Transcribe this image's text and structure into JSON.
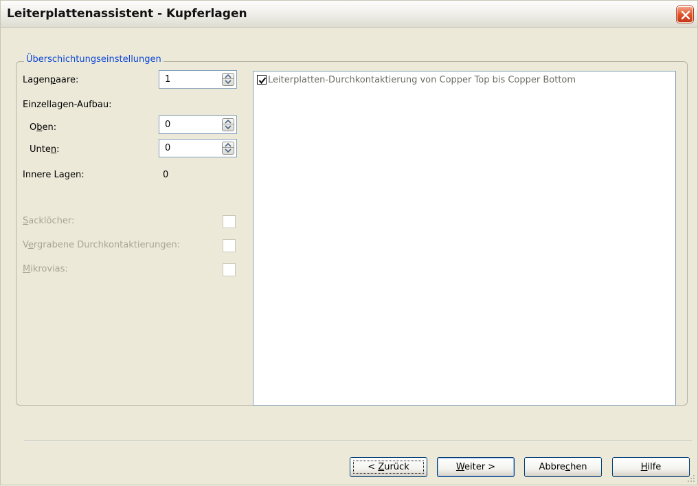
{
  "window": {
    "title": "Leiterplattenassistent - Kupferlagen"
  },
  "group": {
    "legend": "Überschichtungseinstellungen"
  },
  "layer_pairs": {
    "label_pre": "Lagen",
    "label_key": "p",
    "label_post": "aare:",
    "value": "1"
  },
  "single_layer_stack": {
    "label": "Einzellagen-Aufbau:"
  },
  "top": {
    "label_pre": "O",
    "label_key": "b",
    "label_post": "en:",
    "value": "0"
  },
  "bottom": {
    "label_pre": "Unte",
    "label_key": "n",
    "label_post": ":",
    "value": "0"
  },
  "inner_layers": {
    "label": "Innere Lagen:",
    "value": "0"
  },
  "blind_vias": {
    "label_key": "S",
    "label_post": "acklöcher:",
    "checked": false
  },
  "buried_vias": {
    "label_pre": "V",
    "label_key": "e",
    "label_post": "rgrabene Durchkontaktierungen:",
    "checked": false
  },
  "microvias": {
    "label_key": "M",
    "label_post": "ikrovias:",
    "checked": false
  },
  "via_list": {
    "items": [
      {
        "label": "Leiterplatten-Durchkontaktierung von Copper Top bis Copper Bottom",
        "checked": true
      }
    ]
  },
  "buttons": {
    "back_pre": "< ",
    "back_key": "Z",
    "back_post": "urück",
    "next_key": "W",
    "next_post": "eiter >",
    "cancel_pre": "Abbre",
    "cancel_key": "c",
    "cancel_post": "hen",
    "help_key": "H",
    "help_post": "ilfe"
  },
  "colors": {
    "group_legend": "#0b46d8",
    "disabled_text": "#a7a593",
    "window_bg": "#ece9d8",
    "close_button": "#e0542c"
  }
}
